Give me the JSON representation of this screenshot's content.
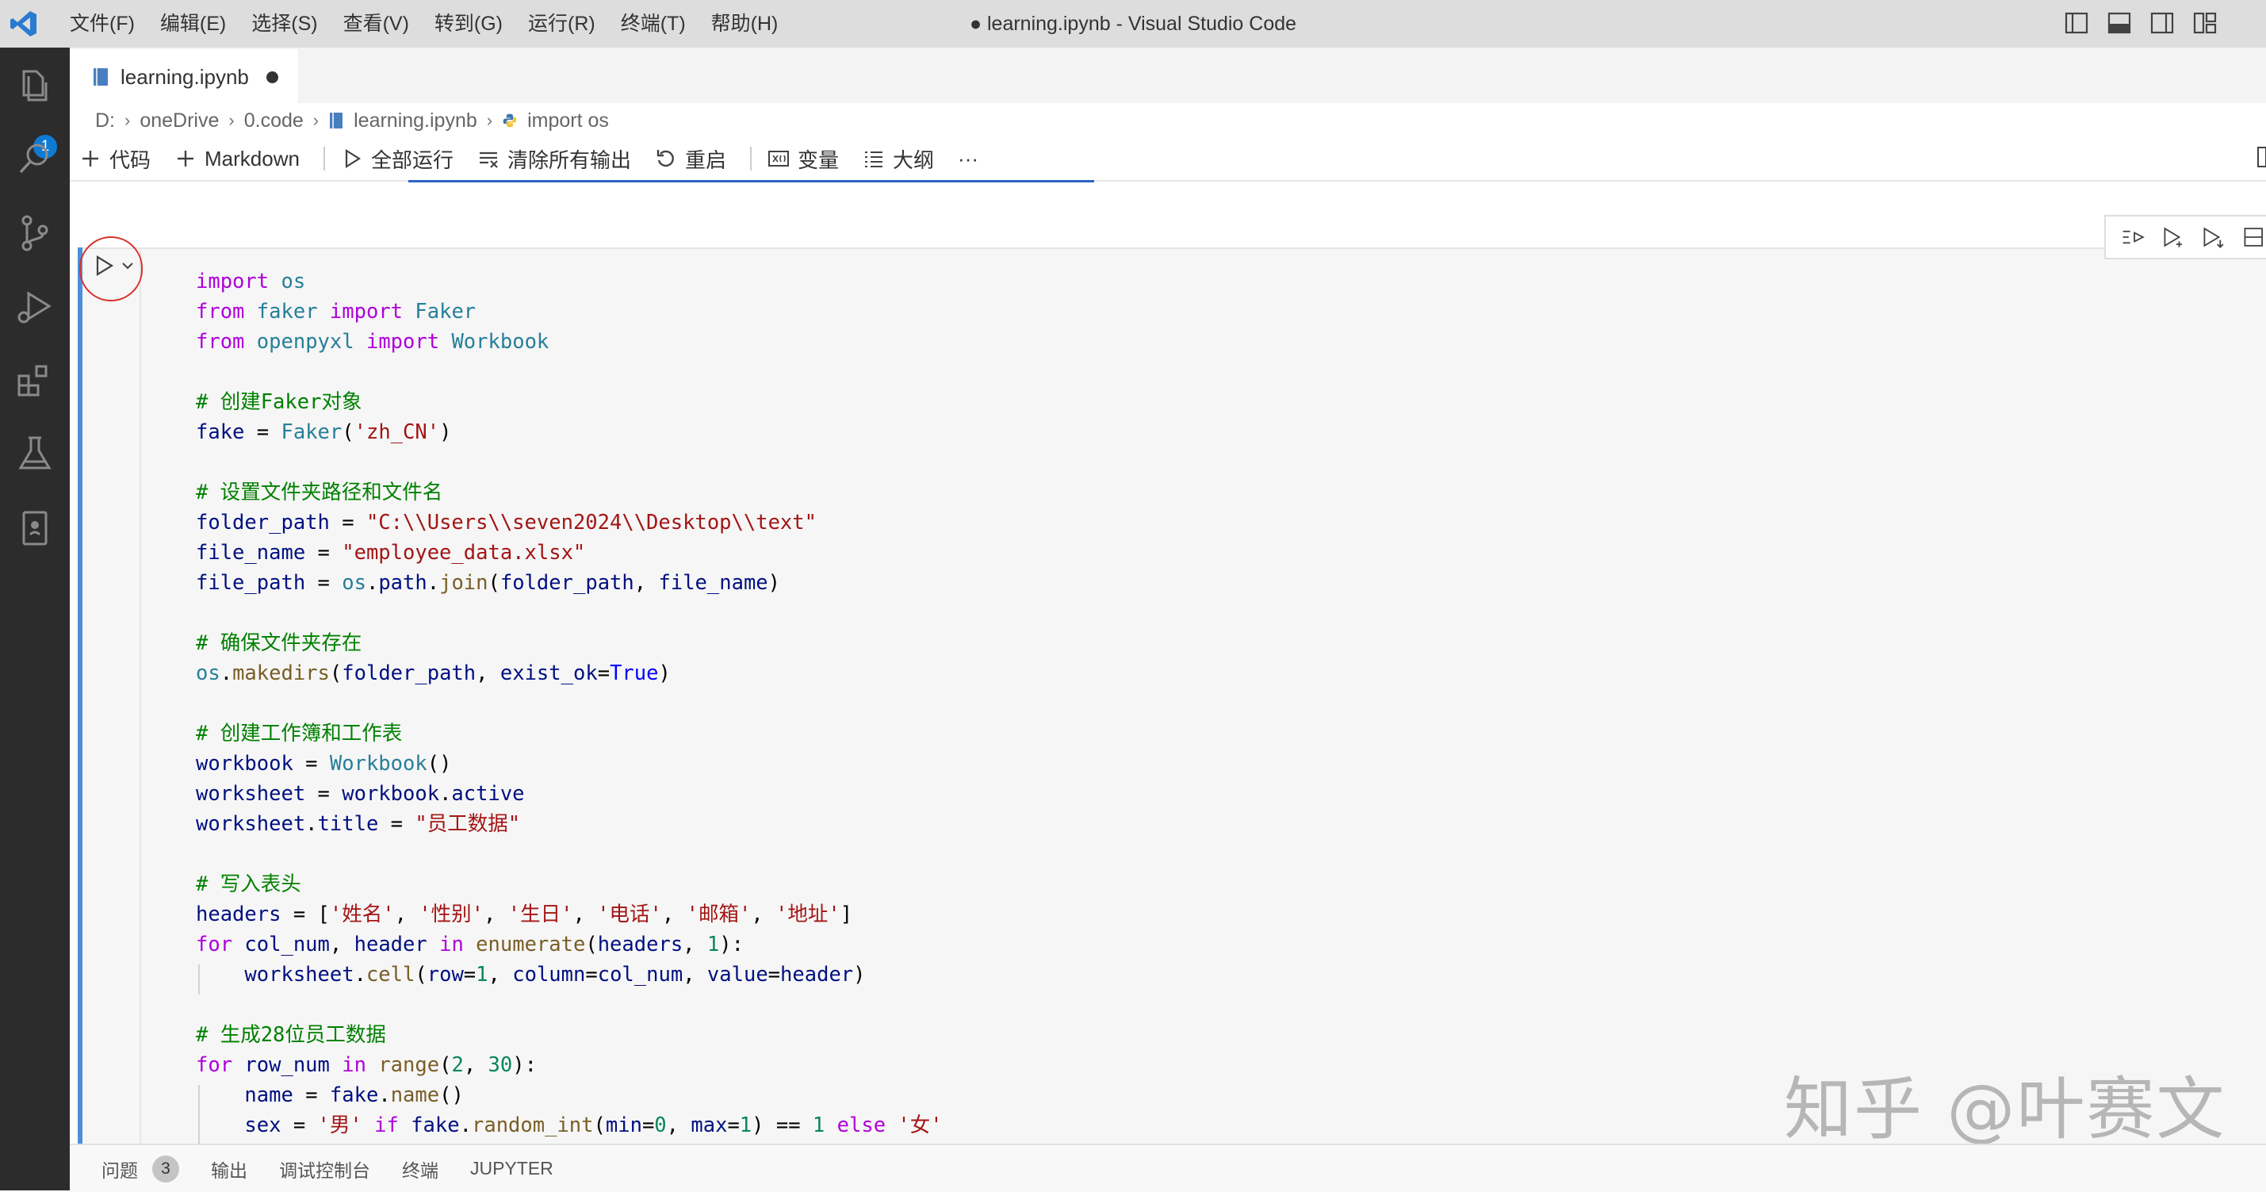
{
  "window": {
    "title": "● learning.ipynb - Visual Studio Code"
  },
  "menu": [
    "文件(F)",
    "编辑(E)",
    "选择(S)",
    "查看(V)",
    "转到(G)",
    "运行(R)",
    "终端(T)",
    "帮助(H)"
  ],
  "activity_bar": {
    "explorer_badge": "1"
  },
  "tab": {
    "label": "learning.ipynb"
  },
  "breadcrumb": [
    "D:",
    "oneDrive",
    "0.code",
    "learning.ipynb",
    "import os"
  ],
  "toolbar": {
    "code": "代码",
    "markdown": "Markdown",
    "run_all": "全部运行",
    "clear_outputs": "清除所有输出",
    "restart": "重启",
    "variables": "变量",
    "outline": "大纲",
    "more": "···"
  },
  "code_lines": [
    [
      [
        "kw",
        "import"
      ],
      [
        "txt",
        " "
      ],
      [
        "mod",
        "os"
      ]
    ],
    [
      [
        "kw",
        "from"
      ],
      [
        "txt",
        " "
      ],
      [
        "mod",
        "faker"
      ],
      [
        "txt",
        " "
      ],
      [
        "kw",
        "import"
      ],
      [
        "txt",
        " "
      ],
      [
        "cls",
        "Faker"
      ]
    ],
    [
      [
        "kw",
        "from"
      ],
      [
        "txt",
        " "
      ],
      [
        "mod",
        "openpyxl"
      ],
      [
        "txt",
        " "
      ],
      [
        "kw",
        "import"
      ],
      [
        "txt",
        " "
      ],
      [
        "cls",
        "Workbook"
      ]
    ],
    [],
    [
      [
        "cmt",
        "# 创建Faker对象"
      ]
    ],
    [
      [
        "var",
        "fake"
      ],
      [
        "txt",
        " = "
      ],
      [
        "cls",
        "Faker"
      ],
      [
        "txt",
        "("
      ],
      [
        "str",
        "'zh_CN'"
      ],
      [
        "txt",
        ")"
      ]
    ],
    [],
    [
      [
        "cmt",
        "# 设置文件夹路径和文件名"
      ]
    ],
    [
      [
        "var",
        "folder_path"
      ],
      [
        "txt",
        " = "
      ],
      [
        "str",
        "\"C:\\\\Users\\\\seven2024\\\\Desktop\\\\text\""
      ]
    ],
    [
      [
        "var",
        "file_name"
      ],
      [
        "txt",
        " = "
      ],
      [
        "str",
        "\"employee_data.xlsx\""
      ]
    ],
    [
      [
        "var",
        "file_path"
      ],
      [
        "txt",
        " = "
      ],
      [
        "mod",
        "os"
      ],
      [
        "txt",
        "."
      ],
      [
        "var",
        "path"
      ],
      [
        "txt",
        "."
      ],
      [
        "fn",
        "join"
      ],
      [
        "txt",
        "("
      ],
      [
        "var",
        "folder_path"
      ],
      [
        "txt",
        ", "
      ],
      [
        "var",
        "file_name"
      ],
      [
        "txt",
        ")"
      ]
    ],
    [],
    [
      [
        "cmt",
        "# 确保文件夹存在"
      ]
    ],
    [
      [
        "mod",
        "os"
      ],
      [
        "txt",
        "."
      ],
      [
        "fn",
        "makedirs"
      ],
      [
        "txt",
        "("
      ],
      [
        "var",
        "folder_path"
      ],
      [
        "txt",
        ", "
      ],
      [
        "var",
        "exist_ok"
      ],
      [
        "txt",
        "="
      ],
      [
        "cst",
        "True"
      ],
      [
        "txt",
        ")"
      ]
    ],
    [],
    [
      [
        "cmt",
        "# 创建工作簿和工作表"
      ]
    ],
    [
      [
        "var",
        "workbook"
      ],
      [
        "txt",
        " = "
      ],
      [
        "cls",
        "Workbook"
      ],
      [
        "txt",
        "()"
      ]
    ],
    [
      [
        "var",
        "worksheet"
      ],
      [
        "txt",
        " = "
      ],
      [
        "var",
        "workbook"
      ],
      [
        "txt",
        "."
      ],
      [
        "var",
        "active"
      ]
    ],
    [
      [
        "var",
        "worksheet"
      ],
      [
        "txt",
        "."
      ],
      [
        "var",
        "title"
      ],
      [
        "txt",
        " = "
      ],
      [
        "str",
        "\"员工数据\""
      ]
    ],
    [],
    [
      [
        "cmt",
        "# 写入表头"
      ]
    ],
    [
      [
        "var",
        "headers"
      ],
      [
        "txt",
        " = ["
      ],
      [
        "str",
        "'姓名'"
      ],
      [
        "txt",
        ", "
      ],
      [
        "str",
        "'性别'"
      ],
      [
        "txt",
        ", "
      ],
      [
        "str",
        "'生日'"
      ],
      [
        "txt",
        ", "
      ],
      [
        "str",
        "'电话'"
      ],
      [
        "txt",
        ", "
      ],
      [
        "str",
        "'邮箱'"
      ],
      [
        "txt",
        ", "
      ],
      [
        "str",
        "'地址'"
      ],
      [
        "txt",
        "]"
      ]
    ],
    [
      [
        "kw",
        "for"
      ],
      [
        "txt",
        " "
      ],
      [
        "var",
        "col_num"
      ],
      [
        "txt",
        ", "
      ],
      [
        "var",
        "header"
      ],
      [
        "txt",
        " "
      ],
      [
        "kw",
        "in"
      ],
      [
        "txt",
        " "
      ],
      [
        "fn",
        "enumerate"
      ],
      [
        "txt",
        "("
      ],
      [
        "var",
        "headers"
      ],
      [
        "txt",
        ", "
      ],
      [
        "num",
        "1"
      ],
      [
        "txt",
        "):"
      ]
    ],
    [
      [
        "txt",
        "    "
      ],
      [
        "var",
        "worksheet"
      ],
      [
        "txt",
        "."
      ],
      [
        "fn",
        "cell"
      ],
      [
        "txt",
        "("
      ],
      [
        "var",
        "row"
      ],
      [
        "txt",
        "="
      ],
      [
        "num",
        "1"
      ],
      [
        "txt",
        ", "
      ],
      [
        "var",
        "column"
      ],
      [
        "txt",
        "="
      ],
      [
        "var",
        "col_num"
      ],
      [
        "txt",
        ", "
      ],
      [
        "var",
        "value"
      ],
      [
        "txt",
        "="
      ],
      [
        "var",
        "header"
      ],
      [
        "txt",
        ")"
      ]
    ],
    [],
    [
      [
        "cmt",
        "# 生成28位员工数据"
      ]
    ],
    [
      [
        "kw",
        "for"
      ],
      [
        "txt",
        " "
      ],
      [
        "var",
        "row_num"
      ],
      [
        "txt",
        " "
      ],
      [
        "kw",
        "in"
      ],
      [
        "txt",
        " "
      ],
      [
        "fn",
        "range"
      ],
      [
        "txt",
        "("
      ],
      [
        "num",
        "2"
      ],
      [
        "txt",
        ", "
      ],
      [
        "num",
        "30"
      ],
      [
        "txt",
        "):"
      ]
    ],
    [
      [
        "txt",
        "    "
      ],
      [
        "var",
        "name"
      ],
      [
        "txt",
        " = "
      ],
      [
        "var",
        "fake"
      ],
      [
        "txt",
        "."
      ],
      [
        "fn",
        "name"
      ],
      [
        "txt",
        "()"
      ]
    ],
    [
      [
        "txt",
        "    "
      ],
      [
        "var",
        "sex"
      ],
      [
        "txt",
        " = "
      ],
      [
        "str",
        "'男'"
      ],
      [
        "txt",
        " "
      ],
      [
        "kw",
        "if"
      ],
      [
        "txt",
        " "
      ],
      [
        "var",
        "fake"
      ],
      [
        "txt",
        "."
      ],
      [
        "fn",
        "random_int"
      ],
      [
        "txt",
        "("
      ],
      [
        "var",
        "min"
      ],
      [
        "txt",
        "="
      ],
      [
        "num",
        "0"
      ],
      [
        "txt",
        ", "
      ],
      [
        "var",
        "max"
      ],
      [
        "txt",
        "="
      ],
      [
        "num",
        "1"
      ],
      [
        "txt",
        ") == "
      ],
      [
        "num",
        "1"
      ],
      [
        "txt",
        " "
      ],
      [
        "kw",
        "else"
      ],
      [
        "txt",
        " "
      ],
      [
        "str",
        "'女'"
      ]
    ]
  ],
  "watermark": "知乎 @叶赛文",
  "panel": {
    "problems": "问题",
    "problems_count": "3",
    "output": "输出",
    "debug_console": "调试控制台",
    "terminal": "终端",
    "jupyter": "JUPYTER"
  }
}
